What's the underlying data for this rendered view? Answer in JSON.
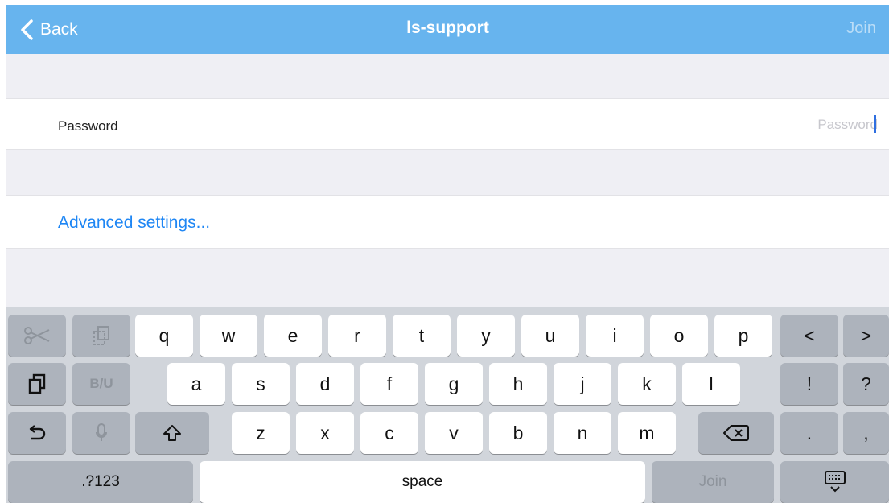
{
  "nav": {
    "back_label": "Back",
    "title": "ls-support",
    "join_label": "Join"
  },
  "form": {
    "password_label": "Password",
    "password_placeholder": "Password",
    "password_value": "",
    "advanced_label": "Advanced settings..."
  },
  "keyboard": {
    "row1": [
      "q",
      "w",
      "e",
      "r",
      "t",
      "y",
      "u",
      "i",
      "o",
      "p"
    ],
    "row2": [
      "a",
      "s",
      "d",
      "f",
      "g",
      "h",
      "j",
      "k",
      "l"
    ],
    "row3": [
      "z",
      "x",
      "c",
      "v",
      "b",
      "n",
      "m"
    ],
    "left_arrow": "<",
    "right_arrow": ">",
    "exclamation": "!",
    "question": "?",
    "period": ".",
    "comma": ",",
    "bold_italic_underline": "B/U",
    "numbers_label": ".?123",
    "space_label": "space",
    "join_label": "Join"
  },
  "colors": {
    "nav_bg": "#67b4ee",
    "link": "#1e86f4",
    "caret": "#2f6fe0",
    "keyboard_bg": "#d1d5db"
  },
  "icons": [
    "chevron-left-icon",
    "scissors-icon",
    "copy-icon",
    "paste-icon",
    "undo-icon",
    "microphone-icon",
    "shift-icon",
    "backspace-icon",
    "keyboard-dismiss-icon"
  ]
}
